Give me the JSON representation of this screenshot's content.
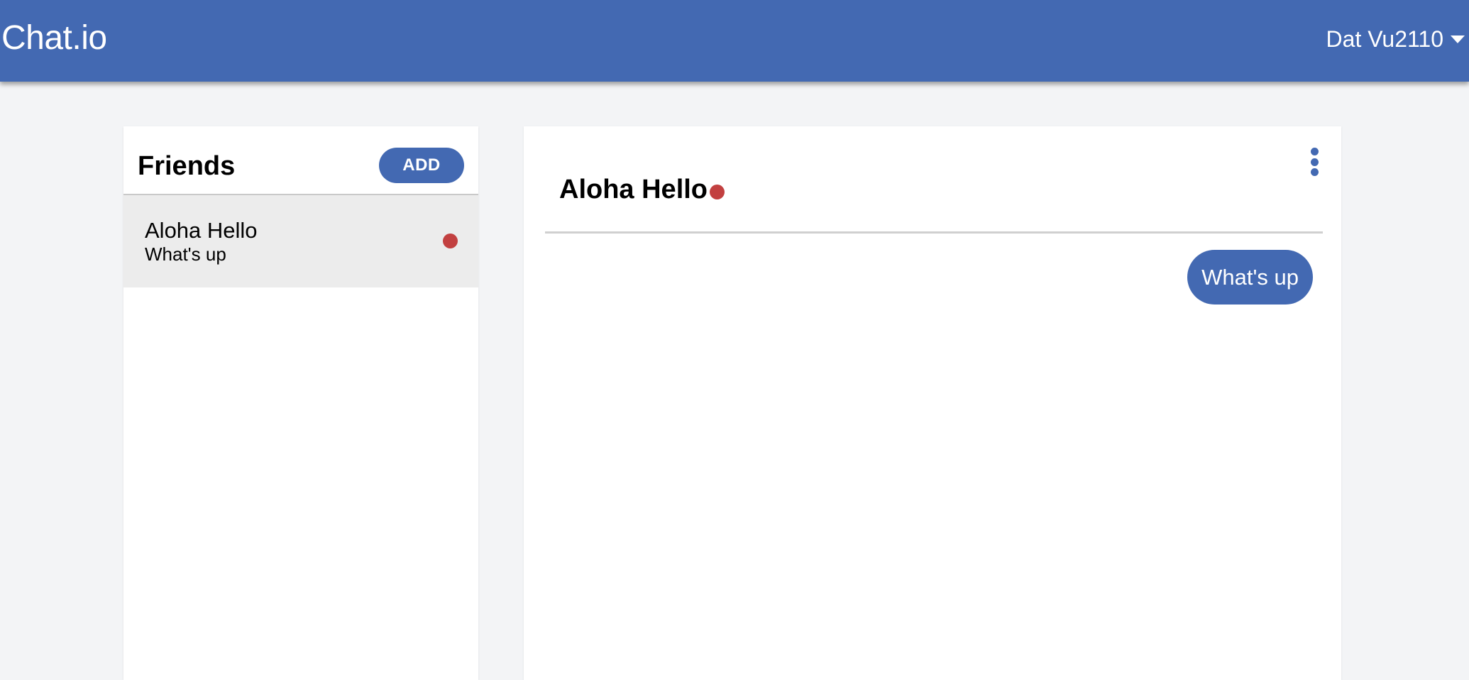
{
  "app": {
    "brand": "Chat.io",
    "user_name": "Dat Vu2110",
    "accent_color": "#4369b2",
    "offline_color": "#c24040"
  },
  "friends": {
    "title": "Friends",
    "add_label": "ADD",
    "items": [
      {
        "name": "Aloha Hello",
        "last_message": "What's up",
        "status": "offline"
      }
    ]
  },
  "chat": {
    "contact_name": "Aloha Hello",
    "contact_status": "offline",
    "menu_icon": "more-vertical-icon",
    "messages": [
      {
        "text": "What's up",
        "from": "me"
      }
    ]
  }
}
